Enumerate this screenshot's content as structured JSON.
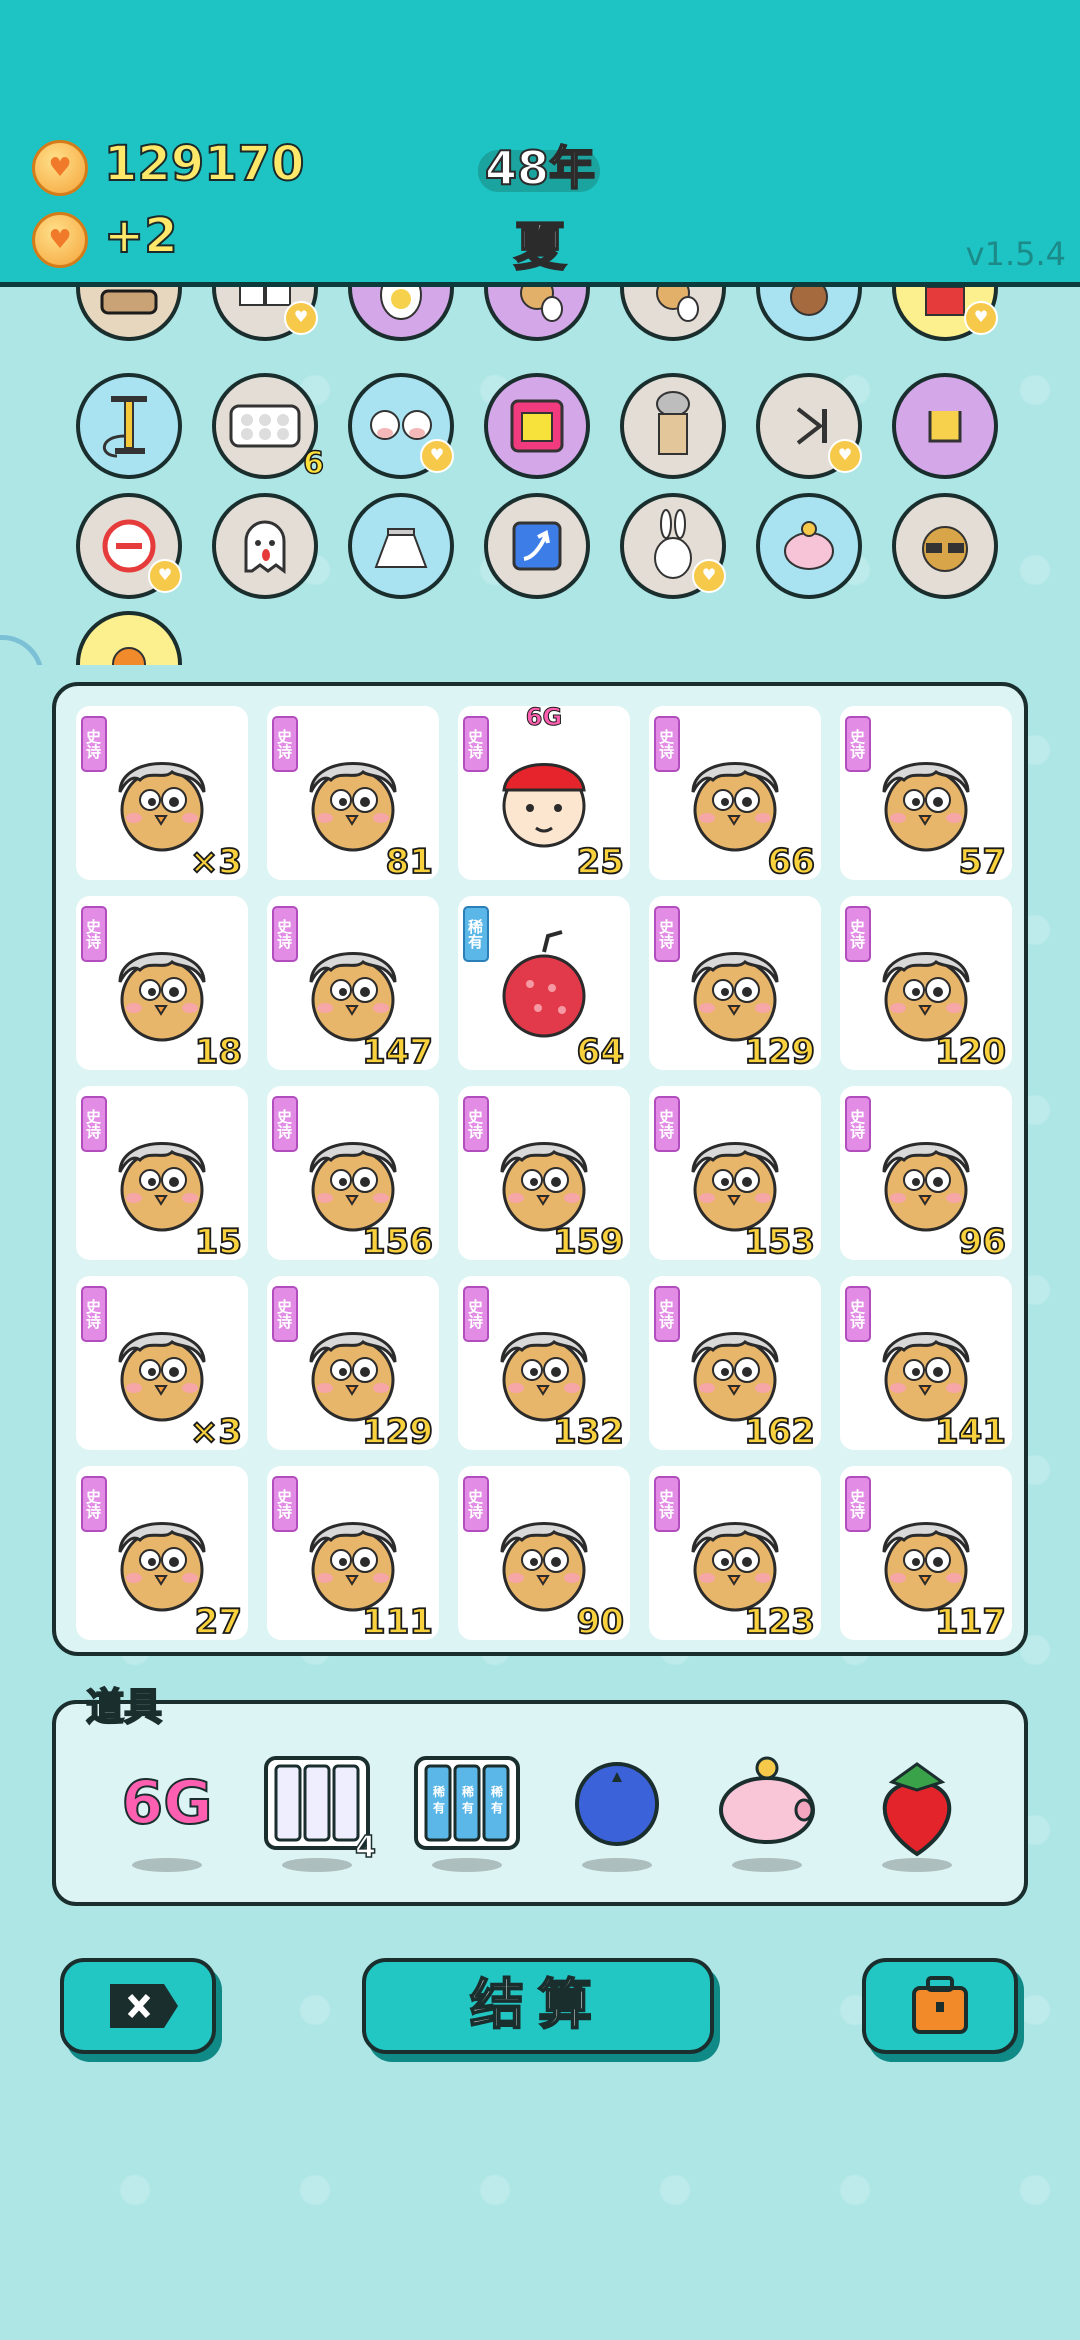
{
  "header": {
    "coins": "129170",
    "income": "+2",
    "year": "48年",
    "season": "夏",
    "version": "v1.5.4"
  },
  "item_icons": [
    "bone-bowl",
    "tofu",
    "egg",
    "chick-egg",
    "chick-egg-2",
    "dog-costume",
    "gift-bag",
    "air-pump",
    "egg-tray",
    "cow-twins",
    "yellow-box",
    "milk-tea",
    "skip-button",
    "rock-hand",
    "minus-sign",
    "ghost",
    "skirt",
    "arrow-card",
    "bunny",
    "piggy-bank",
    "sunglasses-cat",
    "basketball"
  ],
  "egg_tray_count": "6",
  "board": {
    "tag_epic": "史诗",
    "tag_rare": "稀有",
    "cells": [
      {
        "kind": "chick",
        "tag": "epic",
        "num": "×3"
      },
      {
        "kind": "chick",
        "tag": "epic",
        "num": "81"
      },
      {
        "kind": "boy",
        "tag": "epic",
        "num": "25",
        "label": "6G"
      },
      {
        "kind": "chick",
        "tag": "epic",
        "num": "66"
      },
      {
        "kind": "chick",
        "tag": "epic",
        "num": "57"
      },
      {
        "kind": "chick",
        "tag": "epic",
        "num": "18"
      },
      {
        "kind": "chick",
        "tag": "epic",
        "num": "147"
      },
      {
        "kind": "lychee",
        "tag": "rare",
        "num": "64"
      },
      {
        "kind": "chick",
        "tag": "epic",
        "num": "129"
      },
      {
        "kind": "chick",
        "tag": "epic",
        "num": "120"
      },
      {
        "kind": "chick",
        "tag": "epic",
        "num": "15"
      },
      {
        "kind": "chick",
        "tag": "epic",
        "num": "156"
      },
      {
        "kind": "chick",
        "tag": "epic",
        "num": "159"
      },
      {
        "kind": "chick",
        "tag": "epic",
        "num": "153"
      },
      {
        "kind": "chick",
        "tag": "epic",
        "num": "96"
      },
      {
        "kind": "chick",
        "tag": "epic",
        "num": "×3"
      },
      {
        "kind": "chick",
        "tag": "epic",
        "num": "129"
      },
      {
        "kind": "chick",
        "tag": "epic",
        "num": "132"
      },
      {
        "kind": "chick",
        "tag": "epic",
        "num": "162"
      },
      {
        "kind": "chick",
        "tag": "epic",
        "num": "141"
      },
      {
        "kind": "chick",
        "tag": "epic",
        "num": "27"
      },
      {
        "kind": "chick",
        "tag": "epic",
        "num": "111"
      },
      {
        "kind": "chick",
        "tag": "epic",
        "num": "90"
      },
      {
        "kind": "chick",
        "tag": "epic",
        "num": "123"
      },
      {
        "kind": "chick",
        "tag": "epic",
        "num": "117"
      }
    ]
  },
  "props": {
    "title": "道具",
    "items": [
      {
        "icon": "6g-prop",
        "label": "6G"
      },
      {
        "icon": "triple-slot-prop",
        "count": "4"
      },
      {
        "icon": "rare-slot-prop",
        "slot_text": "稀有"
      },
      {
        "icon": "blueberry-prop"
      },
      {
        "icon": "piggy-bank-prop"
      },
      {
        "icon": "strawberry-prop"
      }
    ]
  },
  "buttons": {
    "exit": "exit-icon",
    "settle": "结算",
    "bag": "briefcase-icon"
  }
}
